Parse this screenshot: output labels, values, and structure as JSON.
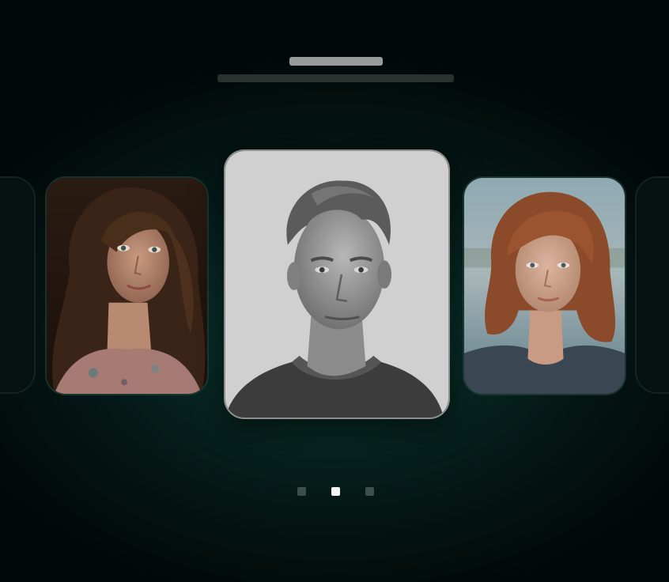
{
  "carousel": {
    "cards": [
      {
        "name": "woman-dark-curly-hair",
        "state": "previous"
      },
      {
        "name": "man-monochrome-portrait",
        "state": "active"
      },
      {
        "name": "woman-auburn-bob",
        "state": "next"
      }
    ],
    "pagination": {
      "count": 3,
      "active_index": 1
    }
  },
  "colors": {
    "background_glow": "#0c3a33",
    "active_dot": "#f2f5f4",
    "inactive_dot": "#3c504b"
  }
}
